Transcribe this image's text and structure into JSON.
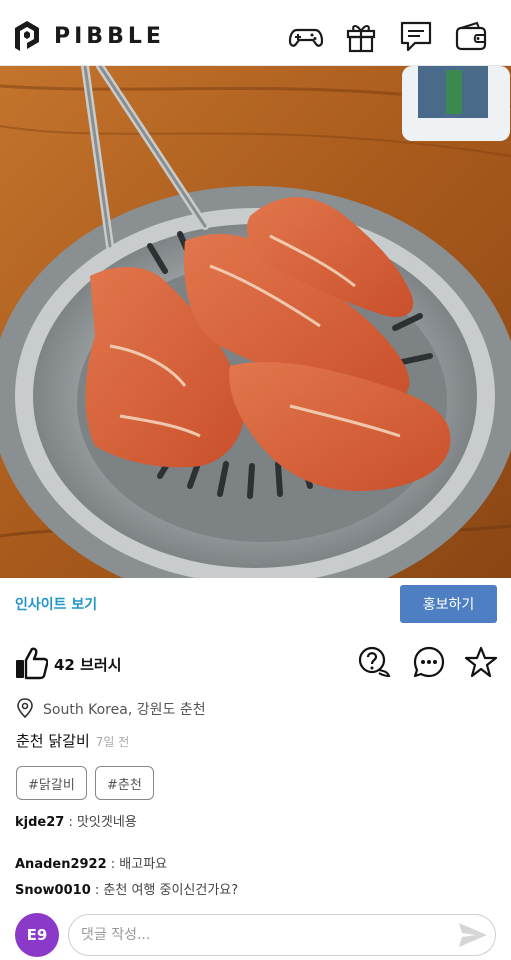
{
  "header": {
    "logo_text": "PIBBLE",
    "icons": [
      "gamepad-icon",
      "gift-icon",
      "chat-icon",
      "wallet-icon"
    ]
  },
  "post": {
    "insight_label": "인사이트 보기",
    "promote_label": "홍보하기",
    "like_count": "42 브러시",
    "location": "South Korea, 강원도 춘천",
    "title": "춘천 닭갈비",
    "time": "7일 전",
    "tags": [
      "#닭갈비",
      "#춘천"
    ],
    "caption": {
      "user": "kjde27",
      "text": " : 맛잇겟네용"
    }
  },
  "comments": [
    {
      "user": "Anaden2922",
      "text": " : 배고파요"
    },
    {
      "user": "Snow0010",
      "text": " : 춘천 여행 중이신건가요?"
    }
  ],
  "composer": {
    "avatar_text": "E9",
    "placeholder": "댓글 작성..."
  },
  "colors": {
    "accent_link": "#2196c9",
    "promote_button": "#4e7fc2",
    "avatar_bg": "#8a39c9"
  }
}
